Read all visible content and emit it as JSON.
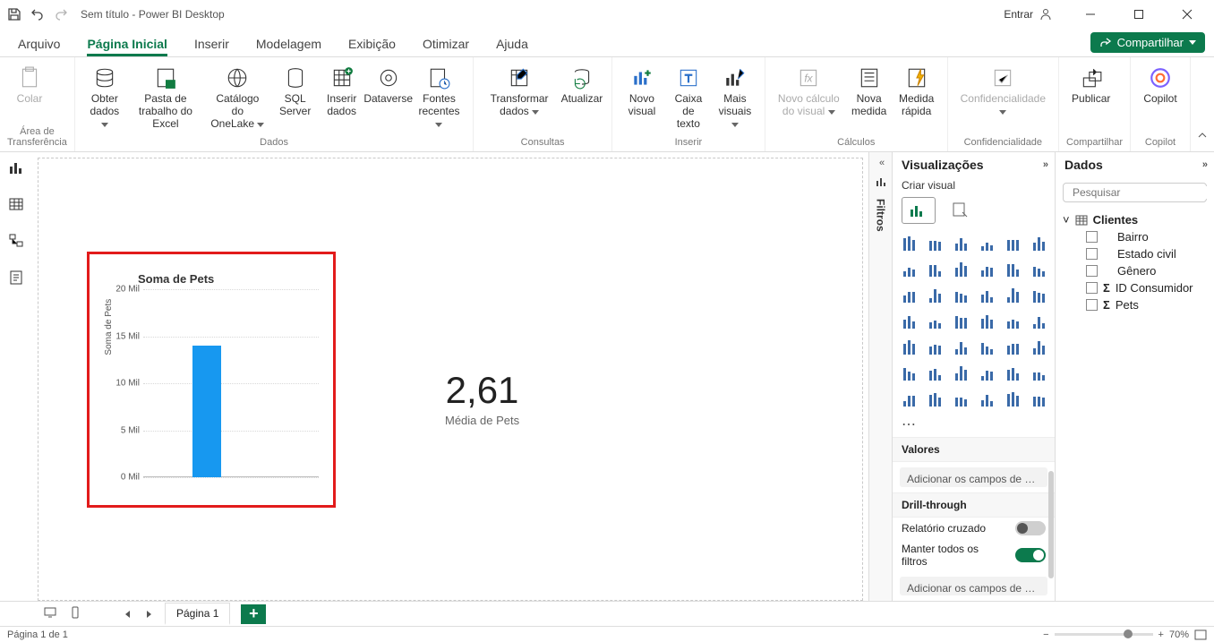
{
  "titlebar": {
    "title": "Sem título - Power BI Desktop",
    "signin": "Entrar"
  },
  "tabs": {
    "items": [
      "Arquivo",
      "Página Inicial",
      "Inserir",
      "Modelagem",
      "Exibição",
      "Otimizar",
      "Ajuda"
    ],
    "active_index": 1,
    "share": "Compartilhar"
  },
  "ribbon": {
    "groups": [
      {
        "label": "Área de Transferência",
        "items": [
          {
            "id": "paste",
            "label": "Colar",
            "disabled": true
          }
        ]
      },
      {
        "label": "Dados",
        "items": [
          {
            "id": "get-data",
            "label": "Obter dados"
          },
          {
            "id": "excel-wb",
            "label": "Pasta de trabalho do Excel"
          },
          {
            "id": "onelake",
            "label": "Catálogo do OneLake"
          },
          {
            "id": "sql",
            "label": "SQL Server"
          },
          {
            "id": "enter-data",
            "label": "Inserir dados"
          },
          {
            "id": "dataverse",
            "label": "Dataverse"
          },
          {
            "id": "recent",
            "label": "Fontes recentes"
          }
        ]
      },
      {
        "label": "Consultas",
        "items": [
          {
            "id": "transform",
            "label": "Transformar dados"
          },
          {
            "id": "refresh",
            "label": "Atualizar"
          }
        ]
      },
      {
        "label": "Inserir",
        "items": [
          {
            "id": "new-visual",
            "label": "Novo visual"
          },
          {
            "id": "text-box",
            "label": "Caixa de texto"
          },
          {
            "id": "more-visuals",
            "label": "Mais visuais"
          }
        ]
      },
      {
        "label": "Cálculos",
        "items": [
          {
            "id": "new-calc",
            "label": "Novo cálculo do visual",
            "disabled": true
          },
          {
            "id": "new-measure",
            "label": "Nova medida"
          },
          {
            "id": "quick-measure",
            "label": "Medida rápida"
          }
        ]
      },
      {
        "label": "Confidencialidade",
        "items": [
          {
            "id": "sensitivity",
            "label": "Confidencialidade",
            "disabled": true
          }
        ]
      },
      {
        "label": "Compartilhar",
        "items": [
          {
            "id": "publish",
            "label": "Publicar"
          }
        ]
      },
      {
        "label": "Copilot",
        "items": [
          {
            "id": "copilot",
            "label": "Copilot"
          }
        ]
      }
    ]
  },
  "left_rail": [
    "report-view",
    "table-view",
    "model-view",
    "dax-view"
  ],
  "filters_label": "Filtros",
  "viz_pane": {
    "title": "Visualizações",
    "subtitle": "Criar visual",
    "values_label": "Valores",
    "values_placeholder": "Adicionar os campos de da...",
    "drill_label": "Drill-through",
    "cross_label": "Relatório cruzado",
    "keep_filters_label": "Manter todos os filtros",
    "drill_placeholder": "Adicionar os campos de dr..."
  },
  "data_pane": {
    "title": "Dados",
    "search_placeholder": "Pesquisar",
    "table": "Clientes",
    "fields": [
      {
        "name": "Bairro",
        "sigma": false
      },
      {
        "name": "Estado civil",
        "sigma": false
      },
      {
        "name": "Gênero",
        "sigma": false
      },
      {
        "name": "ID Consumidor",
        "sigma": true
      },
      {
        "name": "Pets",
        "sigma": true
      }
    ]
  },
  "card": {
    "value": "2,61",
    "label": "Média de Pets"
  },
  "page_bar": {
    "page": "Página 1"
  },
  "status": {
    "page": "Página 1 de 1",
    "zoom": "70%"
  },
  "chart_data": {
    "type": "bar",
    "title": "Soma de Pets",
    "ylabel": "Soma de Pets",
    "ylim": [
      0,
      20000
    ],
    "ticks": [
      0,
      5000,
      10000,
      15000,
      20000
    ],
    "tick_labels": [
      "0 Mil",
      "5 Mil",
      "10 Mil",
      "15 Mil",
      "20 Mil"
    ],
    "categories": [
      ""
    ],
    "values": [
      14000
    ]
  }
}
